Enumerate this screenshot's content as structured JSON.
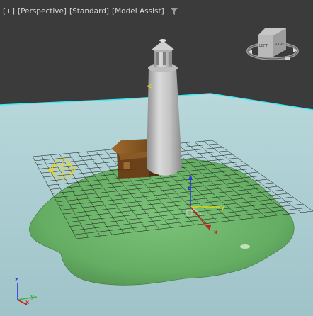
{
  "viewport": {
    "labels": [
      "[+]",
      "[Perspective]",
      "[Standard]",
      "[Model Assist]"
    ],
    "filter_icon": "funnel-icon"
  },
  "viewcube": {
    "left_face": "LEFT",
    "right_face": "RIGHT"
  },
  "gizmo": {
    "x_label": "x",
    "y_label": "y",
    "z_label": "z"
  },
  "corner_axis": {
    "x_label": "x",
    "y_label": "y",
    "z_label": "z"
  },
  "colors": {
    "background": "#3b3b3b",
    "water": "#a8cbcf",
    "horizon": "#3fe6f2",
    "island": "#6cb36b",
    "grid": "#151515",
    "lighthouse": "#c9c9c9",
    "hut": "#8a5a26"
  }
}
